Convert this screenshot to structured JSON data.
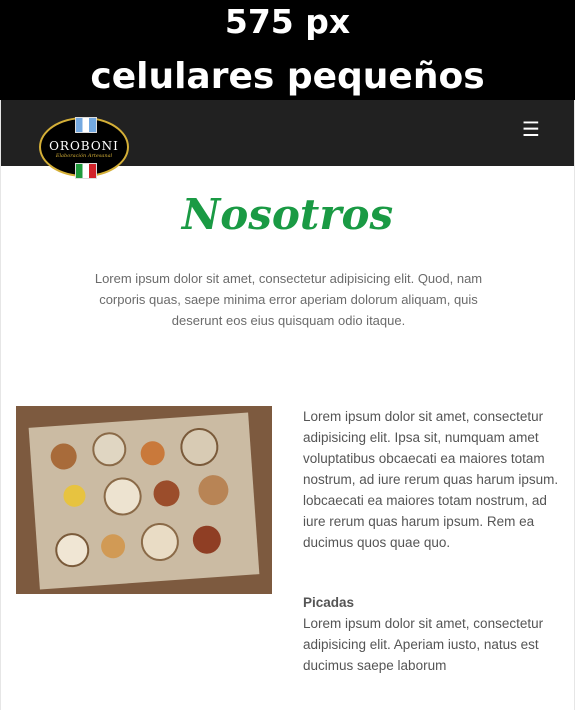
{
  "banner": {
    "line1": "575 px",
    "line2": "celulares pequeños"
  },
  "navbar": {
    "logo_name": "OROBONI",
    "logo_subtitle": "Elaboración Artesanal",
    "menu_icon": "hamburger-menu-icon"
  },
  "main": {
    "title": "Nosotros",
    "intro": "Lorem ipsum dolor sit amet, consectetur adipisicing elit. Quod, nam corporis quas, saepe minima error aperiam dolorum aliquam, quis deserunt eos eius quisquam odio itaque.",
    "image_alt": "mesa de picadas",
    "body": "Lorem ipsum dolor sit amet, consectetur adipisicing elit. Ipsa sit, numquam amet voluptatibus obcaecati ea maiores totam nostrum, ad iure rerum quas harum ipsum. lobcaecati ea maiores totam nostrum, ad iure rerum quas harum ipsum. Rem ea ducimus quos quae quo.",
    "subheading": "Picadas",
    "subtext": "Lorem ipsum dolor sit amet, consectetur adipisicing elit. Aperiam iusto, natus est ducimus saepe laborum"
  },
  "colors": {
    "navbar_bg": "#212121",
    "title_green": "#1a9a44",
    "banner_bg": "#000000"
  }
}
